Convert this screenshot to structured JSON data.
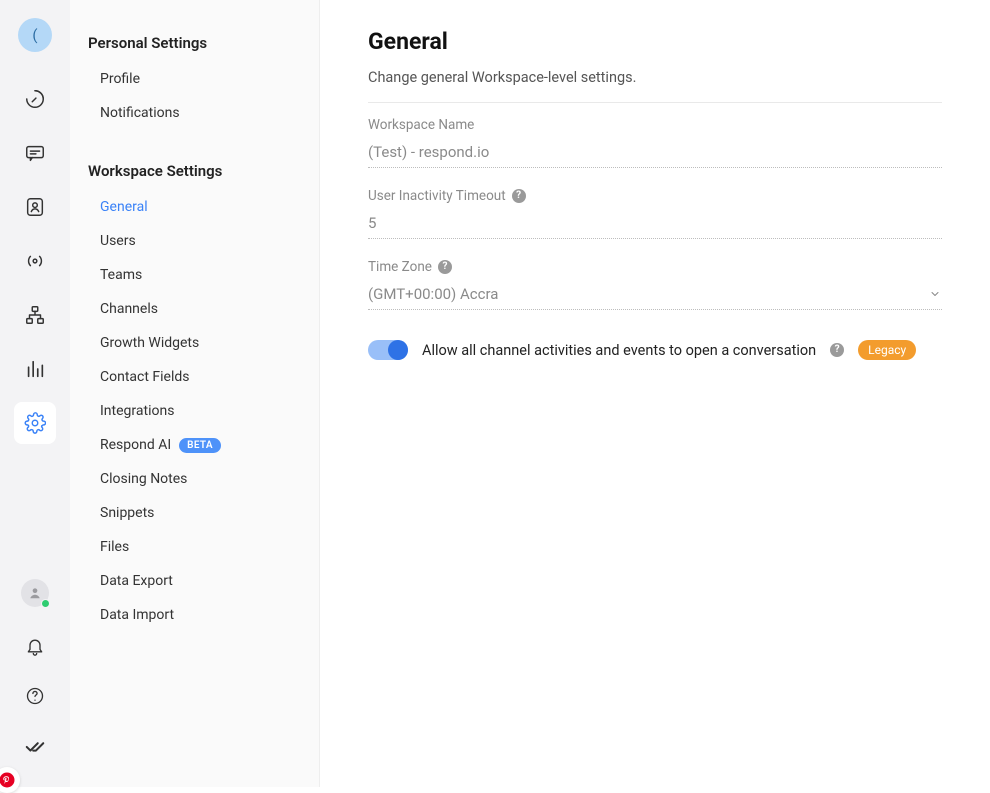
{
  "rail": {
    "avatar_char": "(",
    "icons": [
      "dashboard",
      "messages",
      "contacts",
      "broadcast",
      "workflows",
      "reports",
      "settings"
    ]
  },
  "sidebar": {
    "personal": {
      "title": "Personal Settings",
      "items": [
        {
          "label": "Profile"
        },
        {
          "label": "Notifications"
        }
      ]
    },
    "workspace": {
      "title": "Workspace Settings",
      "items": [
        {
          "label": "General",
          "active": true
        },
        {
          "label": "Users"
        },
        {
          "label": "Teams"
        },
        {
          "label": "Channels"
        },
        {
          "label": "Growth Widgets"
        },
        {
          "label": "Contact Fields"
        },
        {
          "label": "Integrations"
        },
        {
          "label": "Respond AI",
          "badge": "BETA"
        },
        {
          "label": "Closing Notes"
        },
        {
          "label": "Snippets"
        },
        {
          "label": "Files"
        },
        {
          "label": "Data Export"
        },
        {
          "label": "Data Import"
        }
      ]
    }
  },
  "main": {
    "heading": "General",
    "subtitle": "Change general Workspace-level settings.",
    "fields": {
      "workspace_name": {
        "label": "Workspace Name",
        "value": "(Test) - respond.io"
      },
      "inactivity_timeout": {
        "label": "User Inactivity Timeout",
        "value": "5"
      },
      "timezone": {
        "label": "Time Zone",
        "value": "(GMT+00:00) Accra"
      }
    },
    "toggle": {
      "label": "Allow all channel activities and events to open a conversation",
      "badge": "Legacy",
      "on": true
    }
  }
}
